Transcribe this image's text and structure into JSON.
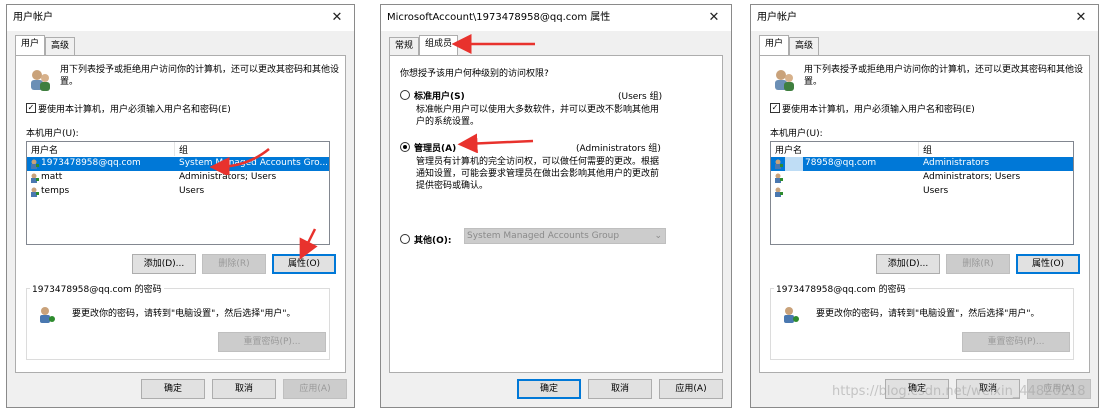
{
  "dialog1": {
    "title": "用户帐户",
    "tabs": [
      "用户",
      "高级"
    ],
    "intro": "用下列表授予或拒绝用户访问你的计算机，还可以更改其密码和其他设置。",
    "checkbox_label": "要使用本计算机，用户必须输入用户名和密码(E)",
    "checkbox_checked": "✓",
    "list_label": "本机用户(U):",
    "columns": [
      "用户名",
      "组"
    ],
    "rows": [
      {
        "name": "1973478958@qq.com",
        "group": "System Managed Accounts Gro..."
      },
      {
        "name": "matt",
        "group": "Administrators; Users"
      },
      {
        "name": "temps",
        "group": "Users"
      }
    ],
    "btn_add": "添加(D)...",
    "btn_remove": "删除(R)",
    "btn_props": "属性(O)",
    "pw_group": "1973478958@qq.com 的密码",
    "pw_text": "要更改你的密码，请转到\"电脑设置\"，然后选择\"用户\"。",
    "btn_reset": "重置密码(P)...",
    "btn_ok": "确定",
    "btn_cancel": "取消",
    "btn_apply": "应用(A)"
  },
  "dialog2": {
    "title": "MicrosoftAccount\\1973478958@qq.com 属性",
    "tabs": [
      "常规",
      "组成员"
    ],
    "question": "你想授予该用户何种级别的访问权限?",
    "opt_standard": "标准用户(S)",
    "opt_standard_group": "(Users 组)",
    "opt_standard_desc": "标准帐户用户可以使用大多数软件，并可以更改不影响其他用户的系统设置。",
    "opt_admin": "管理员(A)",
    "opt_admin_group": "(Administrators 组)",
    "opt_admin_desc": "管理员有计算机的完全访问权，可以做任何需要的更改。根据通知设置，可能会要求管理员在做出会影响其他用户的更改前提供密码或确认。",
    "opt_other": "其他(O):",
    "other_value": "System Managed Accounts Group",
    "btn_ok": "确定",
    "btn_cancel": "取消",
    "btn_apply": "应用(A)"
  },
  "dialog3": {
    "title": "用户帐户",
    "tabs": [
      "用户",
      "高级"
    ],
    "intro": "用下列表授予或拒绝用户访问你的计算机，还可以更改其密码和其他设置。",
    "checkbox_label": "要使用本计算机，用户必须输入用户名和密码(E)",
    "checkbox_checked": "✓",
    "list_label": "本机用户(U):",
    "columns": [
      "用户名",
      "组"
    ],
    "rows": [
      {
        "name": "78958@qq.com",
        "group": "Administrators"
      },
      {
        "name": "",
        "group": "Administrators; Users"
      },
      {
        "name": "",
        "group": "Users"
      }
    ],
    "btn_add": "添加(D)...",
    "btn_remove": "删除(R)",
    "btn_props": "属性(O)",
    "pw_group": "1973478958@qq.com 的密码",
    "pw_text": "要更改你的密码，请转到\"电脑设置\"，然后选择\"用户\"。",
    "btn_reset": "重置密码(P)...",
    "btn_ok": "确定",
    "btn_cancel": "取消",
    "btn_apply": "应用(A)"
  },
  "watermark": "https://blog.csdn.net/weixin_44820218",
  "colors": {
    "selection": "#0078d7",
    "arrow": "#e8322d",
    "dialog_bg": "#f0f0f0"
  }
}
